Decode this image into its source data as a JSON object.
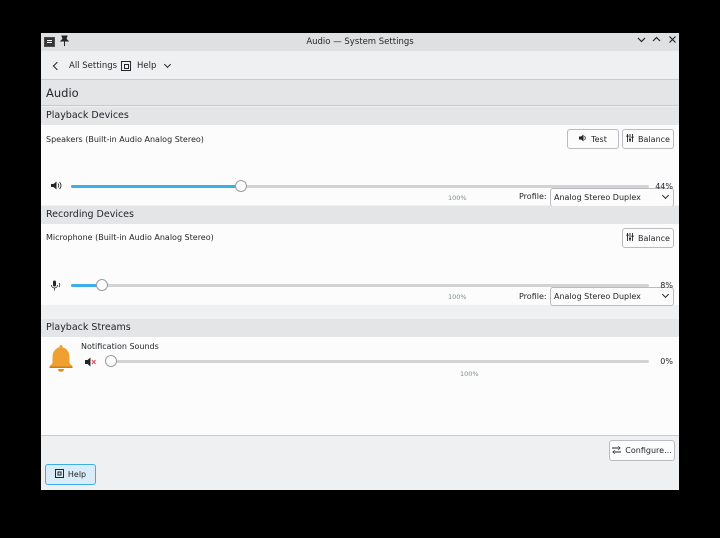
{
  "window": {
    "title": "Audio — System Settings",
    "minimize_glyph": "﹀",
    "maximize_glyph": "︿",
    "close_glyph": "✕",
    "pin_glyph": "📌"
  },
  "toolbar": {
    "back_label": "All Settings",
    "help_label": "Help"
  },
  "page": {
    "title": "Audio"
  },
  "playback_devices": {
    "header": "Playback Devices",
    "device_name": "Speakers (Built-in Audio Analog Stereo)",
    "test_label": "Test",
    "balance_label": "Balance",
    "profile_label": "Profile:",
    "profile_value": "Analog Stereo Duplex",
    "volume_percent": 44,
    "volume_text": "44%",
    "marker_label": "100%",
    "volume_icon": "speaker-icon"
  },
  "recording_devices": {
    "header": "Recording Devices",
    "device_name": "Microphone (Built-in Audio Analog Stereo)",
    "balance_label": "Balance",
    "profile_label": "Profile:",
    "profile_value": "Analog Stereo Duplex",
    "volume_percent": 8,
    "volume_text": "8%",
    "marker_label": "100%",
    "volume_icon": "microphone-icon"
  },
  "playback_streams": {
    "header": "Playback Streams",
    "stream_name": "Notification Sounds",
    "volume_percent": 0,
    "volume_text": "0%",
    "marker_label": "100%",
    "muted": true,
    "stream_icon": "bell-icon"
  },
  "footer": {
    "configure_label": "Configure...",
    "help_label": "Help"
  },
  "colors": {
    "accent": "#3daee9",
    "bell": "#f0a030",
    "window_bg": "#eff0f1",
    "panel_bg": "#fcfcfc"
  }
}
